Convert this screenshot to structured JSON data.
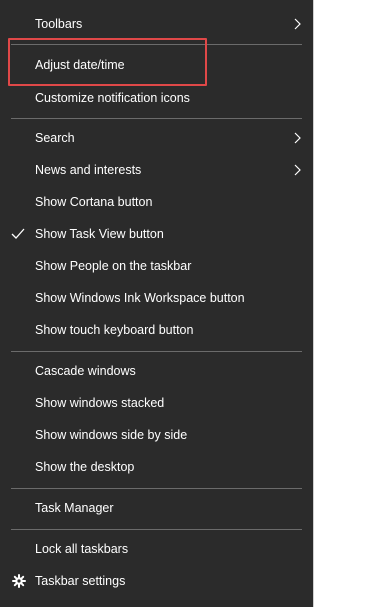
{
  "colors": {
    "menu_bg": "#2b2b2b",
    "text": "#ffffff",
    "separator": "#6b6b6b",
    "annotation": "#e04848"
  },
  "menu": {
    "toolbars": "Toolbars",
    "adjust_datetime": "Adjust date/time",
    "customize_notification_icons": "Customize notification icons",
    "search": "Search",
    "news_and_interests": "News and interests",
    "show_cortana_button": "Show Cortana button",
    "show_task_view_button": "Show Task View button",
    "show_people": "Show People on the taskbar",
    "show_ink_workspace": "Show Windows Ink Workspace button",
    "show_touch_keyboard": "Show touch keyboard button",
    "cascade_windows": "Cascade windows",
    "show_windows_stacked": "Show windows stacked",
    "show_windows_side_by_side": "Show windows side by side",
    "show_the_desktop": "Show the desktop",
    "task_manager": "Task Manager",
    "lock_all_taskbars": "Lock all taskbars",
    "taskbar_settings": "Taskbar settings"
  },
  "icons": {
    "submenu": "chevron-right-icon",
    "checked": "checkmark-icon",
    "settings": "gear-icon"
  },
  "state": {
    "show_task_view_button_checked": true
  }
}
